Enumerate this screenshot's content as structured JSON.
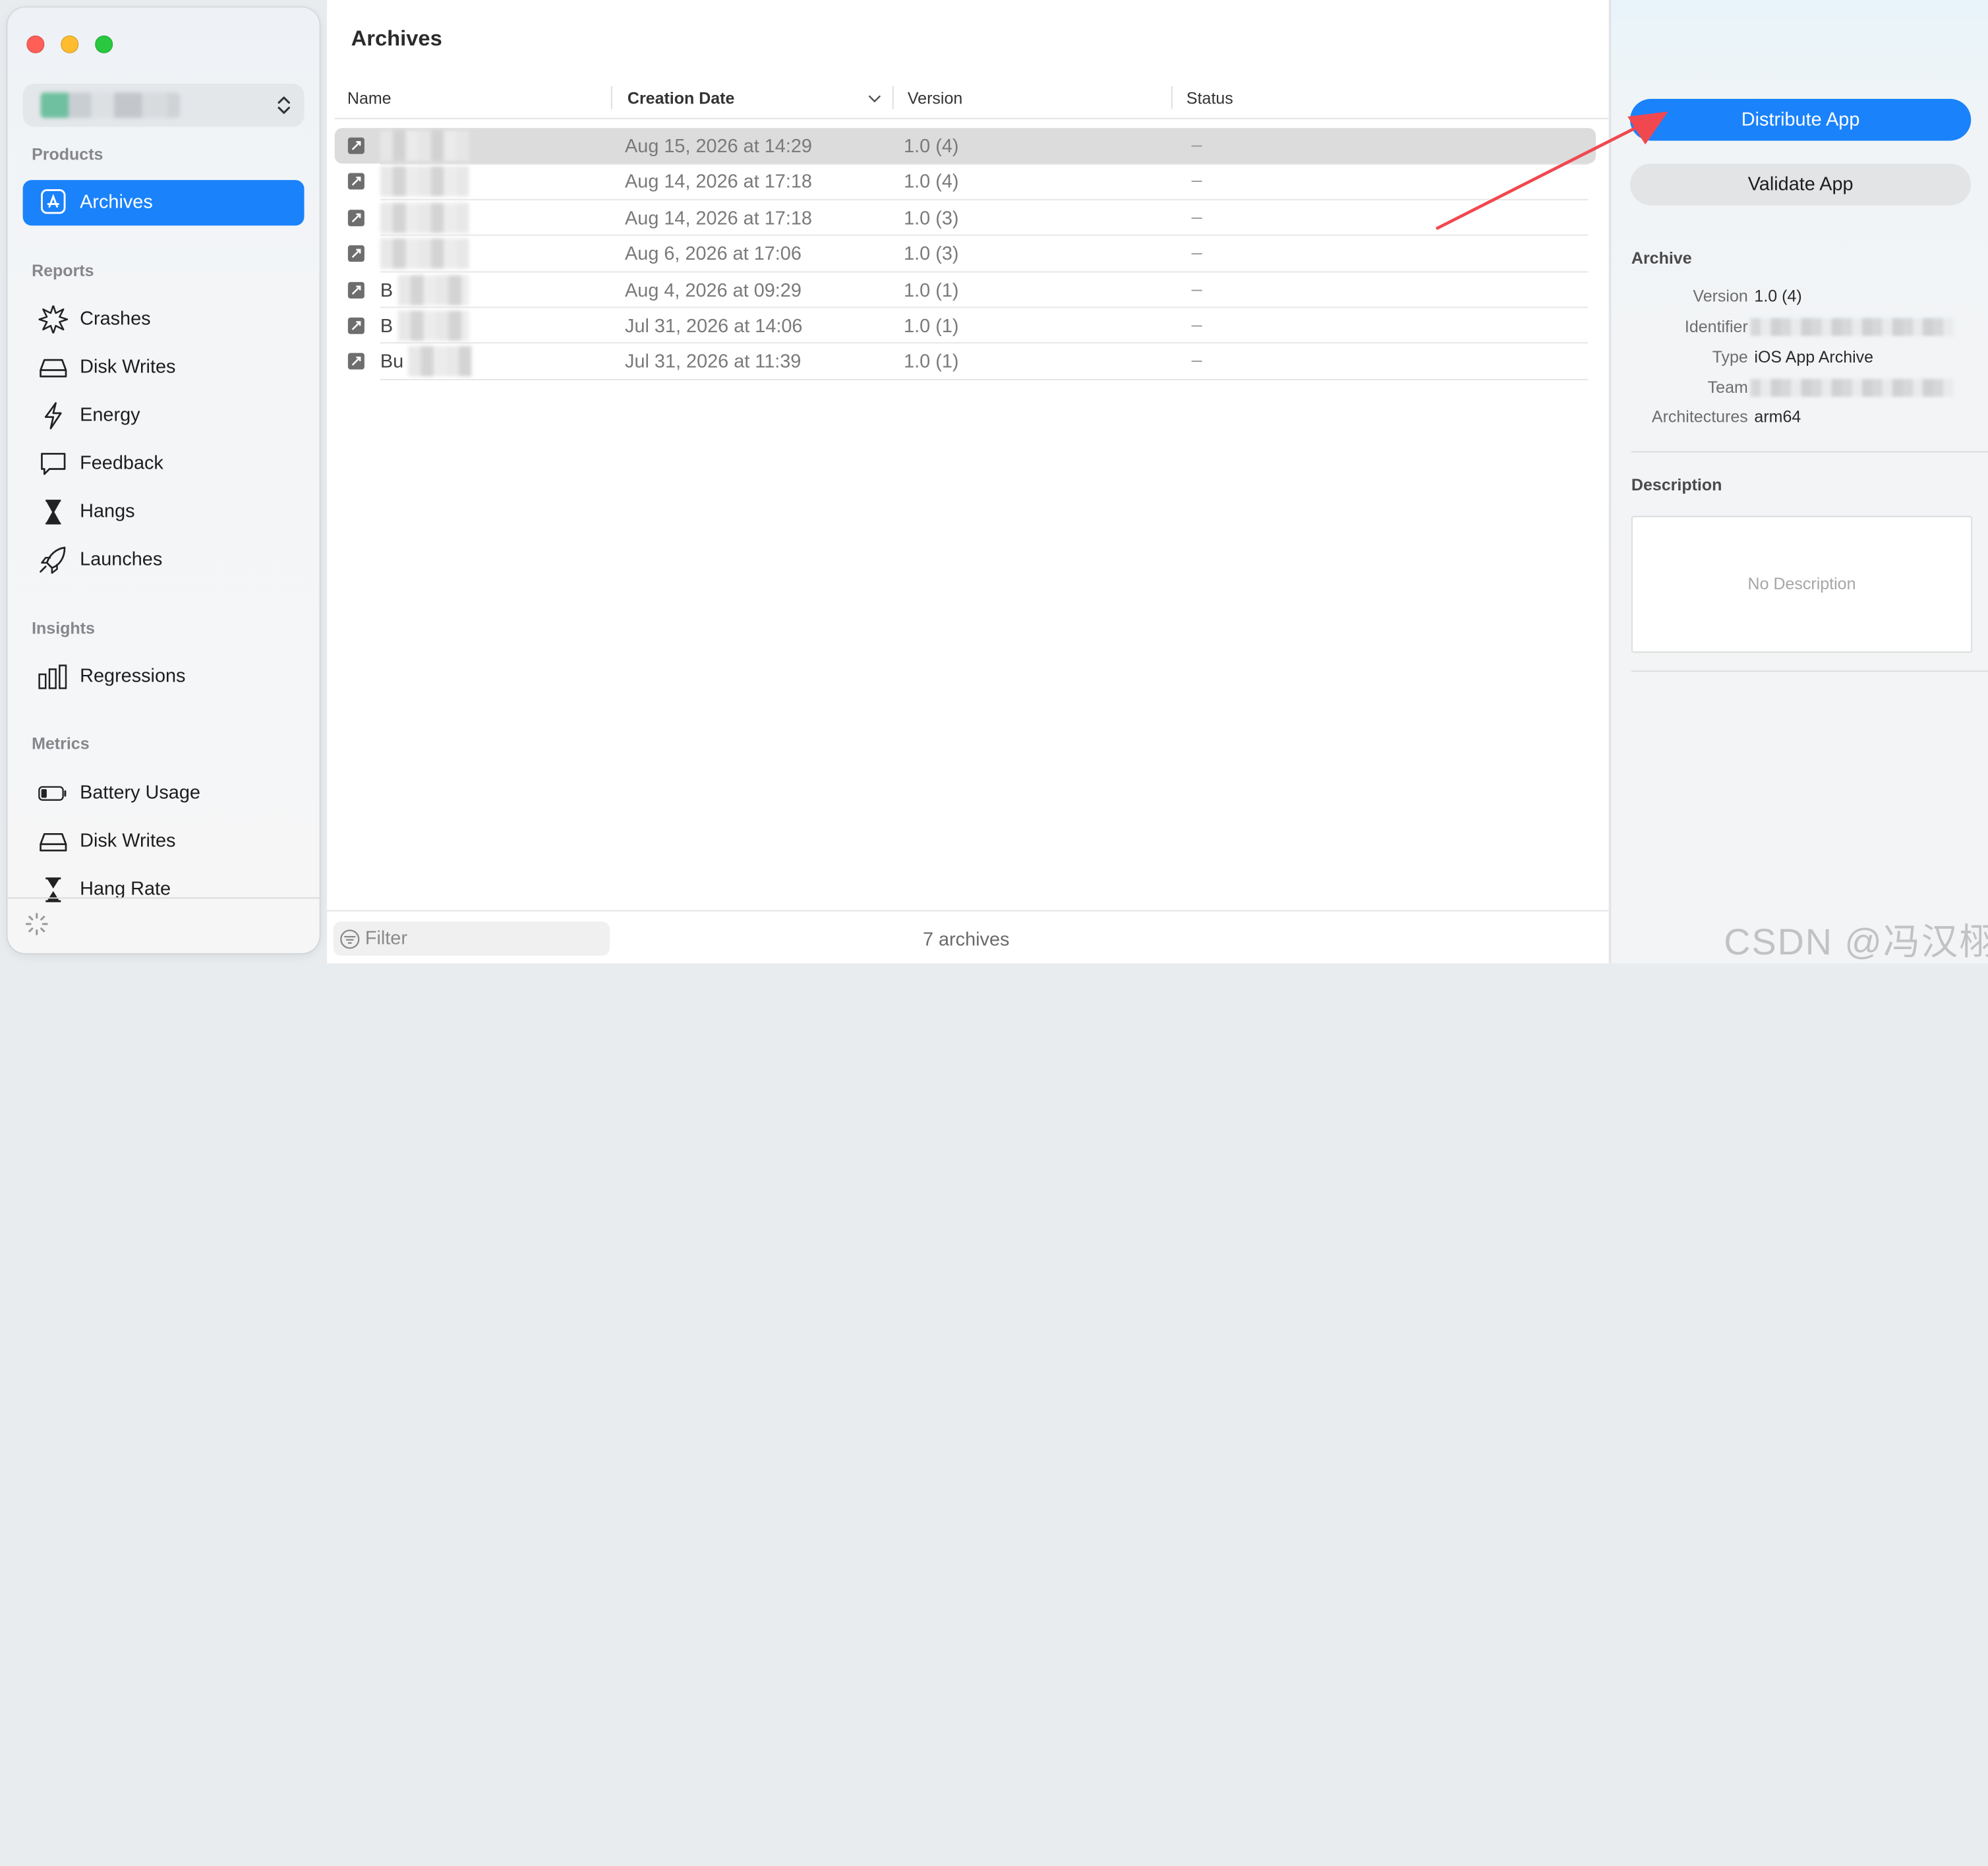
{
  "window": {
    "title": "Archives"
  },
  "sidebar": {
    "sections": {
      "products": "Products",
      "reports": "Reports",
      "insights": "Insights",
      "metrics": "Metrics"
    },
    "items": [
      {
        "label": "Archives",
        "icon": "app-store-icon",
        "active": true
      },
      {
        "label": "Crashes",
        "icon": "crash-icon"
      },
      {
        "label": "Disk Writes",
        "icon": "disk-icon"
      },
      {
        "label": "Energy",
        "icon": "bolt-icon"
      },
      {
        "label": "Feedback",
        "icon": "speech-bubble-icon"
      },
      {
        "label": "Hangs",
        "icon": "hourglass-icon"
      },
      {
        "label": "Launches",
        "icon": "rocket-icon"
      },
      {
        "label": "Regressions",
        "icon": "bars-icon"
      },
      {
        "label": "Battery Usage",
        "icon": "battery-icon"
      },
      {
        "label": "Disk Writes",
        "icon": "disk-icon"
      },
      {
        "label": "Hang Rate",
        "icon": "hourglass-icon"
      }
    ]
  },
  "table": {
    "columns": [
      "Name",
      "Creation Date",
      "Version",
      "Status"
    ],
    "rows": [
      {
        "name": "",
        "date": "Aug 15, 2026 at 14:29",
        "version": "1.0 (4)",
        "status": "–"
      },
      {
        "name": "",
        "date": "Aug 14, 2026 at 17:18",
        "version": "1.0 (4)",
        "status": "–"
      },
      {
        "name": "",
        "date": "Aug 14, 2026 at 17:18",
        "version": "1.0 (3)",
        "status": "–"
      },
      {
        "name": "",
        "date": "Aug 6, 2026 at 17:06",
        "version": "1.0 (3)",
        "status": "–"
      },
      {
        "name": "B",
        "date": "Aug 4, 2026 at 09:29",
        "version": "1.0 (1)",
        "status": "–"
      },
      {
        "name": "B",
        "date": "Jul 31, 2026 at 14:06",
        "version": "1.0 (1)",
        "status": "–"
      },
      {
        "name": "Bu",
        "date": "Jul 31, 2026 at 11:39",
        "version": "1.0 (1)",
        "status": "–"
      }
    ]
  },
  "footer": {
    "filter_placeholder": "Filter",
    "count": "7 archives"
  },
  "inspector": {
    "distribute_label": "Distribute App",
    "validate_label": "Validate App",
    "archive_heading": "Archive",
    "fields": [
      {
        "key": "Version",
        "value": "1.0 (4)"
      },
      {
        "key": "Identifier",
        "value": ""
      },
      {
        "key": "Type",
        "value": "iOS App Archive"
      },
      {
        "key": "Team",
        "value": ""
      },
      {
        "key": "Architectures",
        "value": "arm64"
      }
    ],
    "description_heading": "Description",
    "description_placeholder": "No Description"
  },
  "watermark": "CSDN @冯汉栩",
  "colors": {
    "accent": "#1a82fb",
    "annotation": "#f0484e"
  }
}
